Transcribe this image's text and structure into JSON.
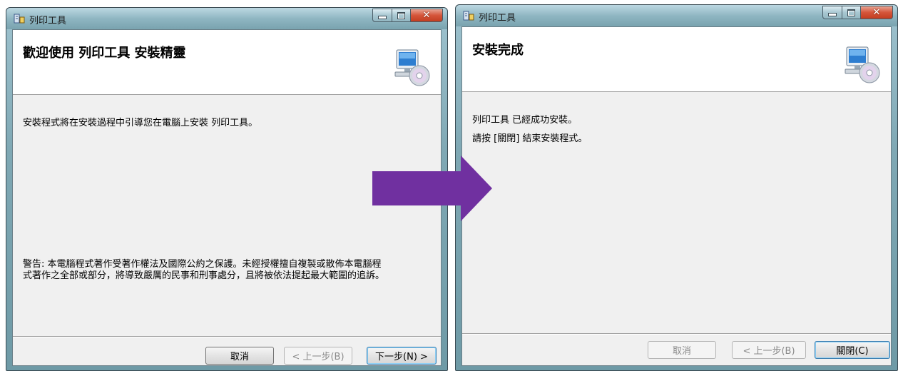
{
  "left_window": {
    "title": "列印工具",
    "header_title": "歡迎使用 列印工具 安裝精靈",
    "intro_text": "安裝程式將在安裝過程中引導您在電腦上安裝 列印工具。",
    "warning_line1": "警告: 本電腦程式著作受著作權法及國際公約之保護。未經授權擅自複製或散佈本電腦程",
    "warning_line2": "式著作之全部或部分，將導致嚴厲的民事和刑事處分，且將被依法提起最大範圍的追訴。",
    "buttons": {
      "cancel": "取消",
      "back": "< 上一步(B)",
      "next": "下一步(N) >"
    }
  },
  "right_window": {
    "title": "列印工具",
    "header_title": "安裝完成",
    "line1": "列印工具 已經成功安裝。",
    "line2": "請按 [關閉] 結束安裝程式。",
    "buttons": {
      "cancel": "取消",
      "back": "< 上一步(B)",
      "close": "關閉(C)"
    }
  },
  "colors": {
    "arrow": "#7030a0",
    "close_button": "#c8402a",
    "title_bar": "#8fb6c2"
  },
  "icons": [
    "setup-icon",
    "computer-cd-icon",
    "minimize-icon",
    "maximize-icon",
    "close-icon",
    "right-arrow-icon"
  ]
}
